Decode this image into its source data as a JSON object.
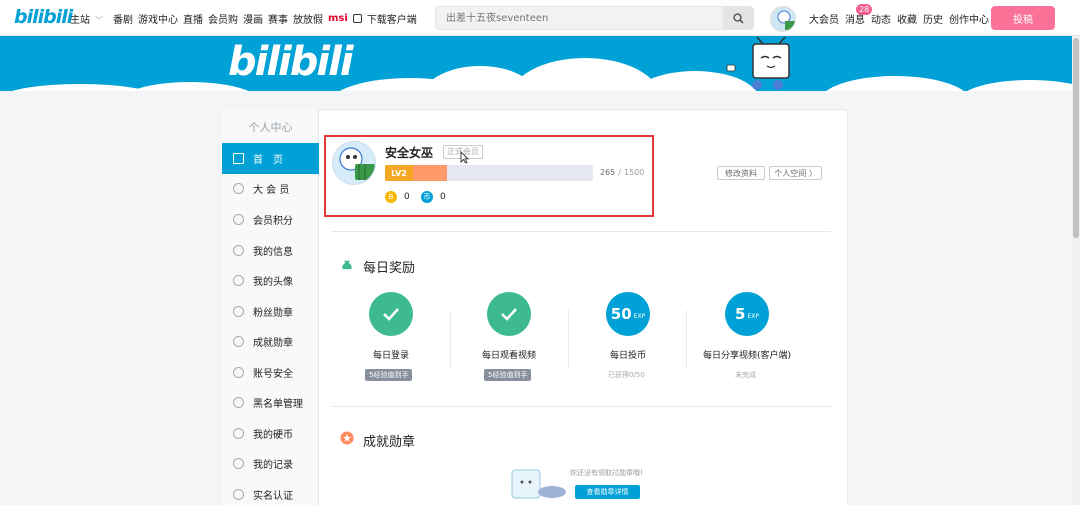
{
  "nav": {
    "logo": "bilibili",
    "links": [
      "主站",
      "番剧",
      "游戏中心",
      "直播",
      "会员购",
      "漫画",
      "赛事",
      "放放假"
    ],
    "msi": "msi",
    "download": "下载客户端",
    "search_placeholder": "出差十五夜seventeen",
    "right_links": [
      "大会员",
      "消息",
      "动态",
      "收藏",
      "历史",
      "创作中心"
    ],
    "message_badge": "28",
    "upload": "投稿"
  },
  "banner": {
    "logo": "bilibili"
  },
  "sidebar": {
    "title": "个人中心",
    "items": [
      "首　页",
      "大 会 员",
      "会员积分",
      "我的信息",
      "我的头像",
      "粉丝勋章",
      "成就勋章",
      "账号安全",
      "黑名单管理",
      "我的硬币",
      "我的记录",
      "实名认证"
    ]
  },
  "profile": {
    "name": "安全女巫",
    "member_tag": "正式会员",
    "level": "LV2",
    "exp_current": "265",
    "exp_max": "1500",
    "exp_fraction": 0.177,
    "coins_b": "0",
    "coins_y": "0",
    "edit_button": "修改资料",
    "space_button": "个人空间 〉"
  },
  "daily": {
    "title": "每日奖励",
    "tasks": [
      {
        "label": "每日登录",
        "status": "5经验值到手",
        "status_done": true,
        "circle_text": ""
      },
      {
        "label": "每日观看视频",
        "status": "5经验值到手",
        "status_done": true,
        "circle_text": ""
      },
      {
        "label": "每日投币",
        "status": "已获得0/50",
        "status_done": false,
        "circle_text": "50",
        "circle_unit": "EXP"
      },
      {
        "label": "每日分享视频(客户端)",
        "status": "未完成",
        "status_done": false,
        "circle_text": "5",
        "circle_unit": "EXP"
      }
    ]
  },
  "achievement": {
    "title": "成就勋章",
    "empty_msg": "你还没有领取过勋章哦!",
    "detail_button": "查看勋章详情"
  },
  "colors": {
    "brand": "#00a1d6",
    "pink": "#fb7299",
    "green": "#3dbb8e",
    "highlight": "#e23a3a"
  }
}
